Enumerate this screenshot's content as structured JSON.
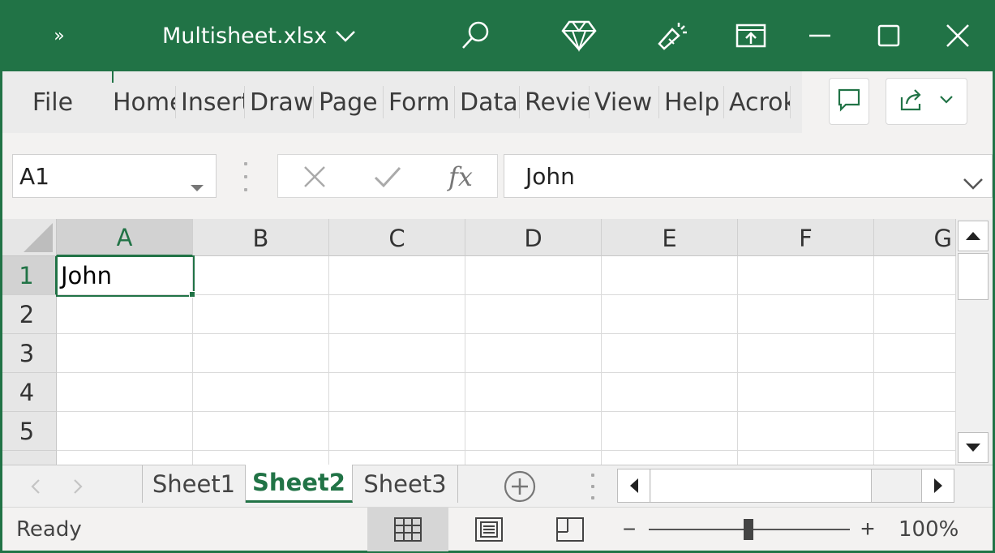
{
  "titlebar": {
    "more_glyph": "»",
    "title": "Multisheet.xlsx",
    "colors": {
      "background": "#217346",
      "foreground": "#ffffff"
    },
    "icons": [
      "more-icon",
      "chevron-down-icon",
      "search-icon",
      "diamond-icon",
      "tell-me-icon",
      "present-icon",
      "minimize-icon",
      "maximize-icon",
      "close-icon"
    ]
  },
  "ribbon": {
    "tabs": [
      "File",
      "Home",
      "Insert",
      "Draw",
      "Page",
      "Form",
      "Data",
      "Revie",
      "View",
      "Help",
      "Acrok"
    ],
    "comment_icon": "comment-icon",
    "share_icon": "share-icon"
  },
  "formula_bar": {
    "name_box": "A1",
    "fx": "fx",
    "value": "John"
  },
  "sheet": {
    "columns": [
      "A",
      "B",
      "C",
      "D",
      "E",
      "F",
      "G"
    ],
    "rows": [
      "1",
      "2",
      "3",
      "4",
      "5"
    ],
    "cells": {
      "A1": "John"
    },
    "active_cell": "A1",
    "accent": "#217346"
  },
  "tabs": {
    "sheets": [
      "Sheet1",
      "Sheet2",
      "Sheet3"
    ],
    "active": "Sheet2"
  },
  "status": {
    "text": "Ready",
    "zoom": "100%",
    "zoom_minus": "−",
    "zoom_plus": "+"
  }
}
